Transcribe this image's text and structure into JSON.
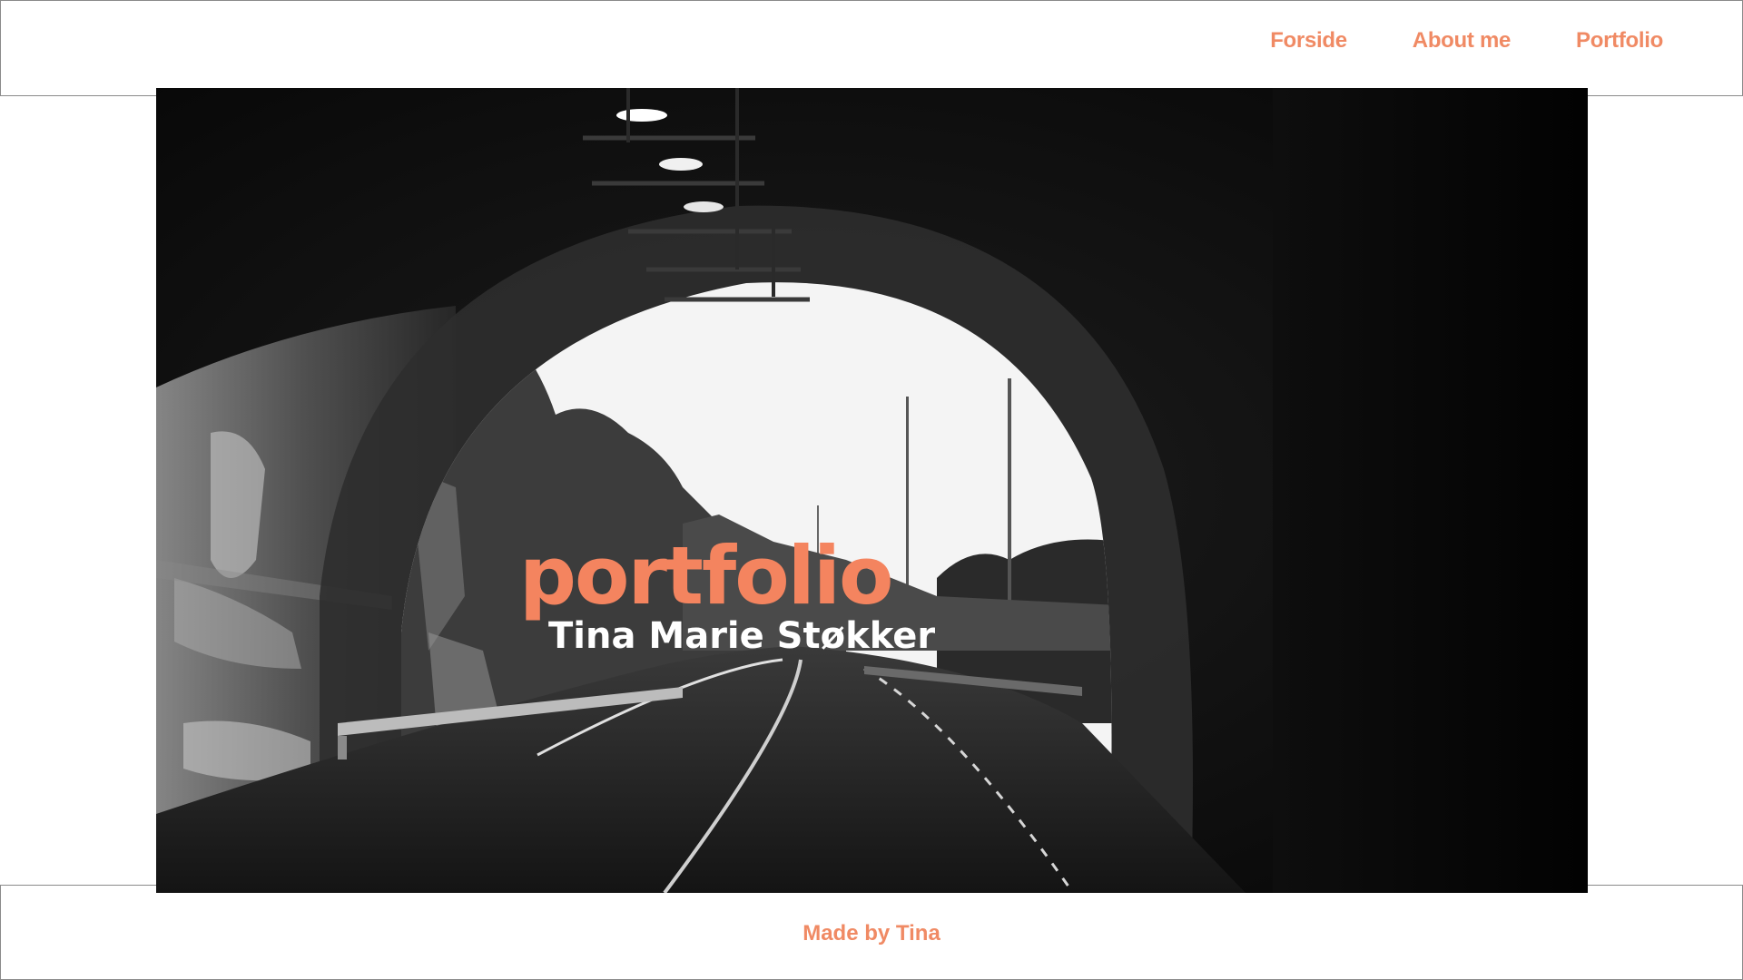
{
  "nav": {
    "items": [
      {
        "label": "Forside"
      },
      {
        "label": "About me"
      },
      {
        "label": "Portfolio"
      }
    ]
  },
  "hero": {
    "title": "portfolio",
    "subtitle": "Tina Marie Støkker",
    "image_description_icon": "tunnel-photo"
  },
  "footer": {
    "text": "Made by Tina"
  },
  "colors": {
    "accent": "#f08a64",
    "title_accent": "#f4845f",
    "border": "#8a8a8a",
    "background": "#ffffff"
  }
}
